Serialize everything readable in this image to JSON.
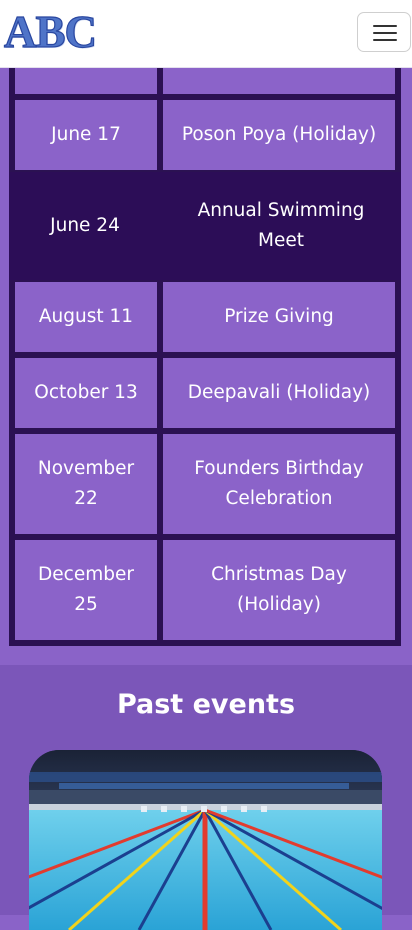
{
  "brand": {
    "logo_text": "ABC"
  },
  "nav": {
    "toggle_icon": "hamburger-menu-icon"
  },
  "events_table": {
    "rows": [
      {
        "date": "",
        "event": ""
      },
      {
        "date": "June 17",
        "event": "Poson Poya (Holiday)"
      },
      {
        "date": "June 24",
        "event": "Annual Swimming Meet",
        "highlighted": true
      },
      {
        "date": "August 11",
        "event": "Prize Giving"
      },
      {
        "date": "October 13",
        "event": "Deepavali (Holiday)"
      },
      {
        "date": "November 22",
        "event": "Founders Birthday Celebration"
      },
      {
        "date": "December 25",
        "event": "Christmas Day (Holiday)"
      }
    ]
  },
  "past_events": {
    "heading": "Past events",
    "image_subject": "swimming-pool-image"
  },
  "colors": {
    "cell_bg": "#8b63c9",
    "border": "#2b1152",
    "highlight_row": "#2c0d57",
    "section_bg": "#7b56b9",
    "logo": "#4f74c8"
  }
}
